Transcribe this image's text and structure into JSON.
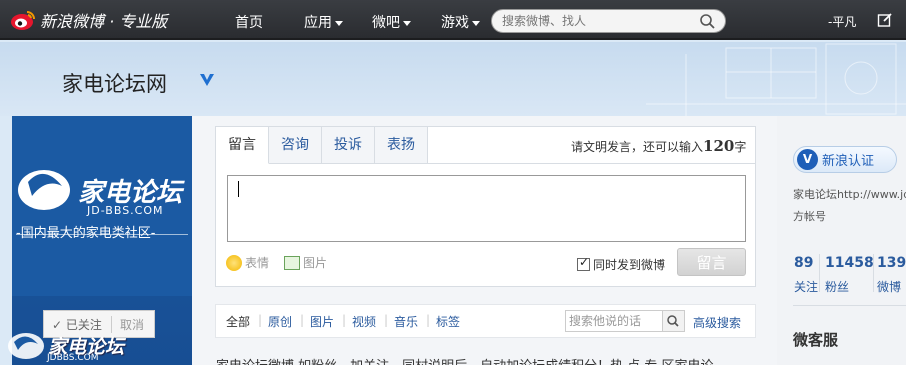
{
  "topnav": {
    "brand": "新浪微博 · 专业版",
    "items": [
      {
        "label": "首页",
        "has_menu": false
      },
      {
        "label": "应用",
        "has_menu": true
      },
      {
        "label": "微吧",
        "has_menu": true
      },
      {
        "label": "游戏",
        "has_menu": true
      }
    ],
    "search_placeholder": "搜索微博、找人",
    "user": "-平凡"
  },
  "banner": {
    "title": "家电论坛网"
  },
  "profile": {
    "brand": "家电论坛",
    "url": "JD-BBS.COM",
    "slogan": "-国内最大的家电类社区-",
    "followed": "✓ 已关注",
    "cancel": "取消",
    "watermark": "家电论坛",
    "watermark_url": "JDBBS.COM"
  },
  "composer": {
    "tabs": [
      "留言",
      "咨询",
      "投诉",
      "表扬"
    ],
    "hint_prefix": "请文明发言，还可以输入",
    "hint_count": "120",
    "hint_suffix": "字",
    "emoji_label": "表情",
    "image_label": "图片",
    "sync_label": "同时发到微博",
    "submit": "留言"
  },
  "filter": {
    "items": [
      "全部",
      "原创",
      "图片",
      "视频",
      "音乐",
      "标签"
    ],
    "search_placeholder": "搜索他说的话",
    "advanced": "高级搜索"
  },
  "stream_preview": "家电论坛微博 如粉丝、加关注、同村说明后，自动加论坛成绩积分！热 点 专 区家电论",
  "sidebar": {
    "badge": "新浪认证",
    "desc_line1": "家电论坛http://www.jd-bbs.com官",
    "desc_line2": "方帐号",
    "stats": [
      {
        "num": "89",
        "label": "关注"
      },
      {
        "num": "11458",
        "label": "粉丝"
      },
      {
        "num": "139",
        "label": "微博"
      }
    ],
    "section_title": "微客服"
  },
  "colors": {
    "nav_bg": "#2e3034",
    "link": "#2b5b9e",
    "profile_bg": "#1c59a1"
  }
}
